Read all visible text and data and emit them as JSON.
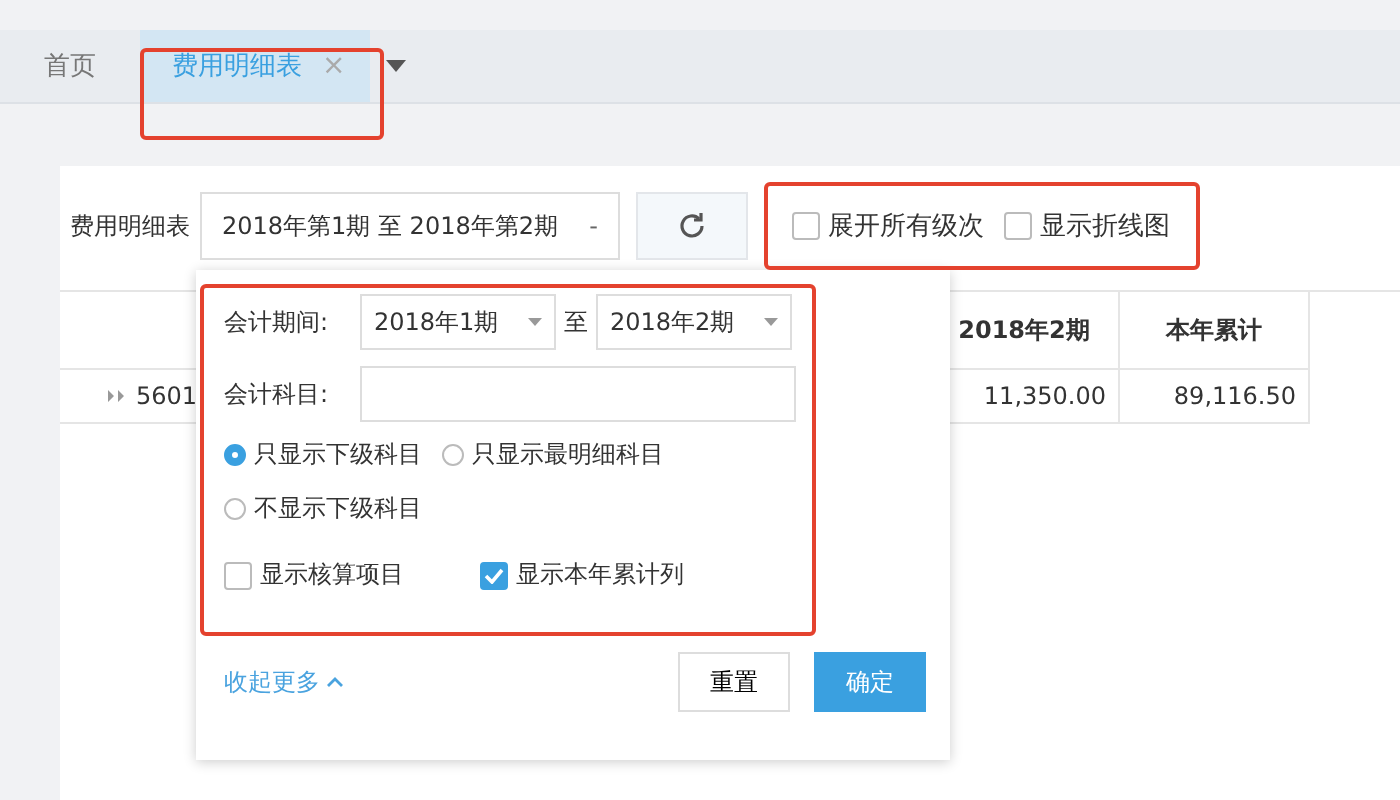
{
  "tabs": [
    {
      "label": "首页",
      "selected": false
    },
    {
      "label": "费用明细表",
      "selected": true,
      "close": "×"
    }
  ],
  "toolbar": {
    "label": "费用明细表",
    "period": "2018年第1期 至 2018年第2期",
    "period_caret": "-",
    "options": [
      {
        "label": "展开所有级次",
        "checked": false
      },
      {
        "label": "显示折线图",
        "checked": false
      }
    ]
  },
  "table": {
    "columns": [
      "",
      "2018年2期",
      "本年累计"
    ],
    "rows": [
      {
        "cells": [
          "5601",
          "11,350.00",
          "89,116.50"
        ]
      }
    ]
  },
  "filter": {
    "period_label": "会计期间:",
    "from": "2018年1期",
    "to_label": "至",
    "to": "2018年2期",
    "subject_label": "会计科目:",
    "radios": [
      {
        "label": "只显示下级科目",
        "selected": true
      },
      {
        "label": "只显示最明细科目",
        "selected": false
      },
      {
        "label": "不显示下级科目",
        "selected": false
      }
    ],
    "checks": [
      {
        "label": "显示核算项目",
        "checked": false
      },
      {
        "label": "显示本年累计列",
        "checked": true
      }
    ],
    "collapse": "收起更多",
    "reset": "重置",
    "ok": "确定"
  }
}
